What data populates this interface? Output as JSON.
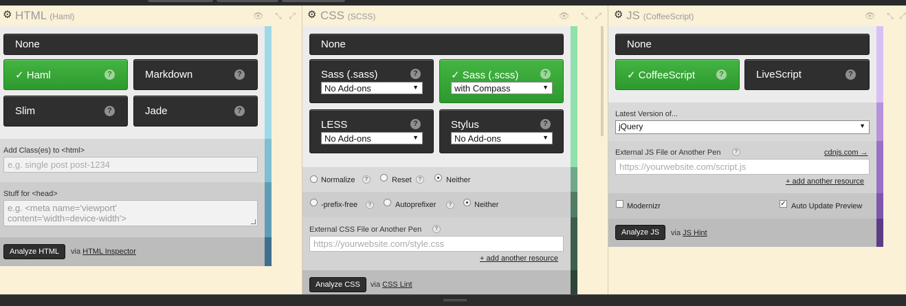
{
  "colors": {
    "green": "#2f9e2f",
    "dark_button": "#2f2f2f",
    "background": "#fbf1d7",
    "html_strip": "#8ccfe0",
    "css_strip": "#7ed79f",
    "js_strip": "#b995de"
  },
  "html": {
    "title": "HTML",
    "subtitle": "(Haml)",
    "icons": [
      "gear-icon",
      "eye-icon",
      "collapse-icon",
      "expand-icon"
    ],
    "none_label": "None",
    "preprocessors": [
      {
        "label": "✓ Haml",
        "selected": true,
        "help": "?"
      },
      {
        "label": "Markdown",
        "selected": false,
        "help": "?"
      },
      {
        "label": "Slim",
        "selected": false,
        "help": "?"
      },
      {
        "label": "Jade",
        "selected": false,
        "help": "?"
      }
    ],
    "class_label": "Add Class(es) to <html>",
    "class_placeholder": "e.g. single post post-1234",
    "head_label": "Stuff for <head>",
    "head_placeholder_1": "e.g. <meta name='viewport'",
    "head_placeholder_2": "content='width=device-width'>",
    "analyze_label": "Analyze HTML",
    "via": "via",
    "inspector": "HTML Inspector"
  },
  "css": {
    "title": "CSS",
    "subtitle": "(SCSS)",
    "none_label": "None",
    "preprocessors": [
      {
        "label": "Sass (.sass)",
        "select": "No Add-ons",
        "selected": false,
        "help": "?"
      },
      {
        "label": "✓  Sass (.scss)",
        "select": "with Compass",
        "selected": true,
        "help": "?"
      },
      {
        "label": "LESS",
        "select": "No Add-ons",
        "selected": false,
        "help": "?"
      },
      {
        "label": "Stylus",
        "select": "No Add-ons",
        "selected": false,
        "help": "?"
      }
    ],
    "base_options": {
      "normalize": "Normalize",
      "reset": "Reset",
      "neither": "Neither",
      "help": "?",
      "selected": "Neither"
    },
    "prefix_options": {
      "prefixfree": "-prefix-free",
      "autoprefixer": "Autoprefixer",
      "neither": "Neither",
      "help": "?",
      "selected": "Neither"
    },
    "external_label": "External CSS File or Another Pen",
    "external_help": "?",
    "external_placeholder": "https://yourwebsite.com/style.css",
    "add_resource": "+ add another resource",
    "analyze_label": "Analyze CSS",
    "via": "via",
    "lint": "CSS Lint"
  },
  "js": {
    "title": "JS",
    "subtitle": "(CoffeeScript)",
    "none_label": "None",
    "preprocessors": [
      {
        "label": "✓ CoffeeScript",
        "selected": true,
        "help": "?"
      },
      {
        "label": "LiveScript",
        "selected": false,
        "help": "?"
      }
    ],
    "latest_label": "Latest Version of...",
    "latest_value": "jQuery",
    "external_label": "External JS File or Another Pen",
    "external_help": "?",
    "cdnjs": "cdnjs.com →",
    "external_placeholder": "https://yourwebsite.com/script.js",
    "add_resource": "+ add another resource",
    "modernizr": "Modernizr",
    "modernizr_checked": false,
    "auto_update": "Auto Update Preview",
    "auto_update_checked": true,
    "analyze_label": "Analyze JS",
    "via": "via",
    "hint": "JS Hint"
  }
}
